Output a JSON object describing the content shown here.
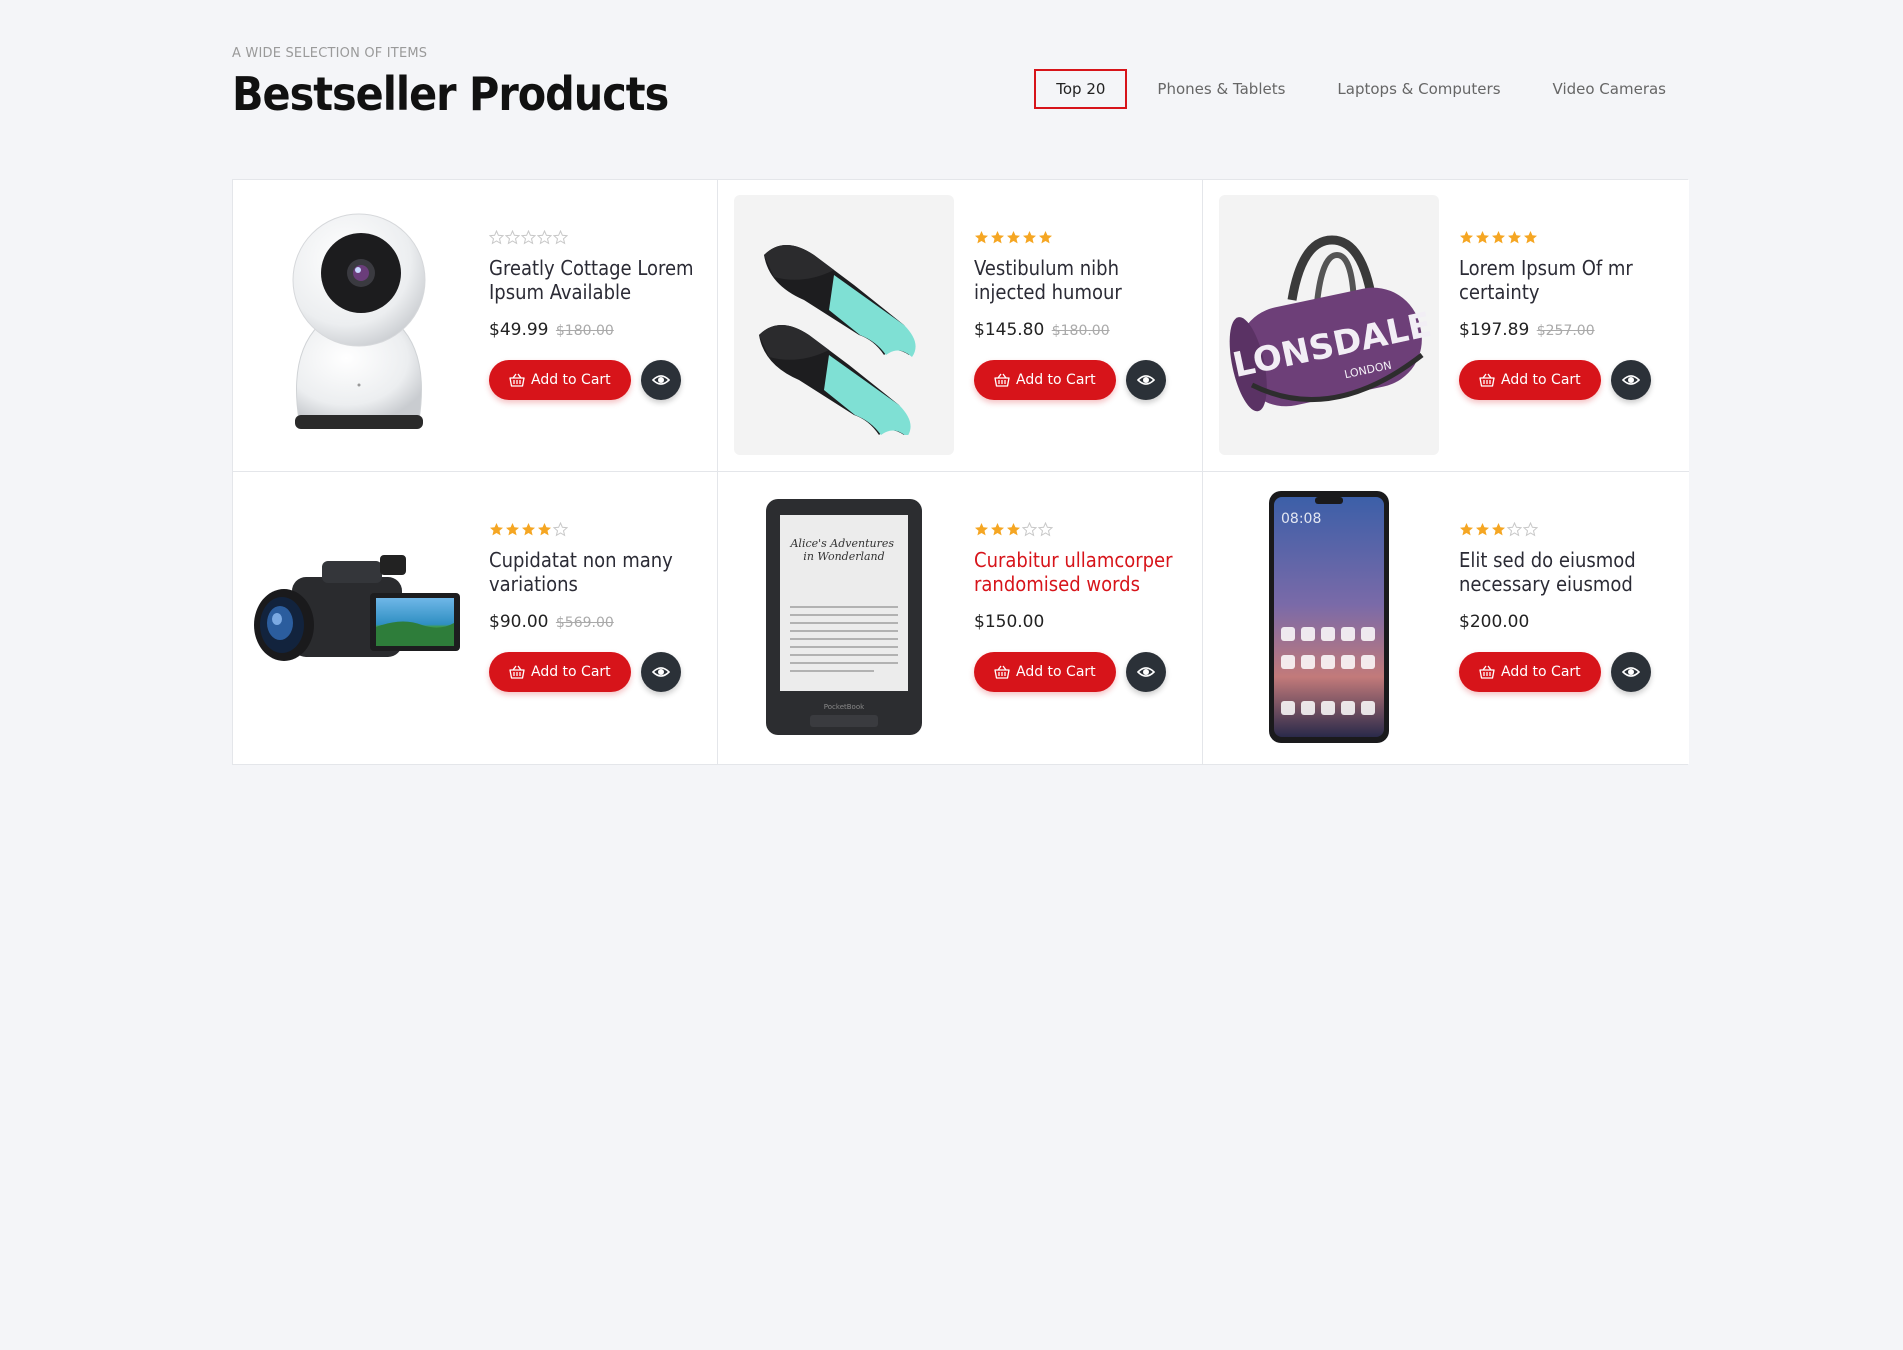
{
  "header": {
    "kicker": "A WIDE SELECTION OF ITEMS",
    "title": "Bestseller Products"
  },
  "tabs": [
    {
      "label": "Top 20",
      "active": true
    },
    {
      "label": "Phones & Tablets",
      "active": false
    },
    {
      "label": "Laptops & Computers",
      "active": false
    },
    {
      "label": "Video Cameras",
      "active": false
    }
  ],
  "colors": {
    "accent": "#d7141a",
    "star_filled": "#f5a623",
    "star_empty": "#c8c8c8",
    "dark_button": "#2b3138"
  },
  "buttons": {
    "add_to_cart": "Add to Cart",
    "quick_view_icon": "eye-icon",
    "cart_icon": "basket-icon"
  },
  "products": [
    {
      "name": "Greatly Cottage Lorem Ipsum Available",
      "rating": 0,
      "price": "$49.99",
      "old_price": "$180.00",
      "image": "security-camera-image",
      "highlight": false
    },
    {
      "name": "Vestibulum nibh injected humour",
      "rating": 5,
      "price": "$145.80",
      "old_price": "$180.00",
      "image": "swim-fins-image",
      "highlight": false
    },
    {
      "name": "Lorem Ipsum Of mr certainty",
      "rating": 5,
      "price": "$197.89",
      "old_price": "$257.00",
      "image": "duffel-bag-image",
      "highlight": false,
      "bag_text": "LONSDALE",
      "bag_subtext": "LONDON"
    },
    {
      "name": "Cupidatat non many variations",
      "rating": 4,
      "price": "$90.00",
      "old_price": "$569.00",
      "image": "camcorder-image",
      "highlight": false
    },
    {
      "name": "Curabitur ullamcorper randomised words",
      "rating": 3,
      "price": "$150.00",
      "old_price": "",
      "image": "ereader-image",
      "highlight": true,
      "ereader_title": "Alice's Adventures in Wonderland",
      "ereader_brand": "PocketBook"
    },
    {
      "name": "Elit sed do eiusmod necessary eiusmod",
      "rating": 3,
      "price": "$200.00",
      "old_price": "",
      "image": "smartphone-image",
      "highlight": false,
      "phone_time": "08:08"
    }
  ]
}
